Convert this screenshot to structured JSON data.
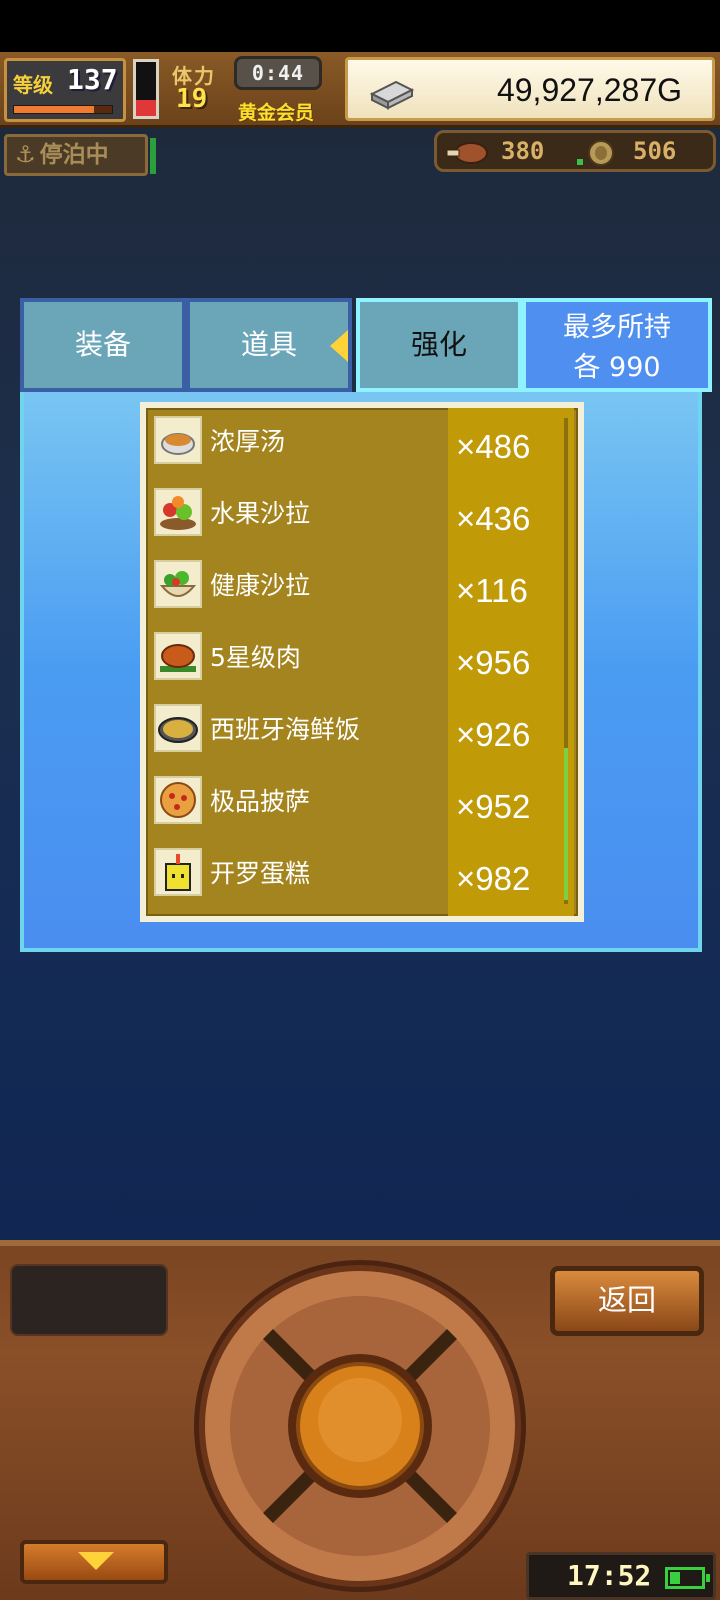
{
  "hud": {
    "level_label": "等级",
    "level_value": "137",
    "exp_fraction": 0.82,
    "stamina_fraction": 0.3,
    "stamina_label": "体力",
    "stamina_value": "19",
    "timer": "0:44",
    "member_label": "黄金会员",
    "gold": "49,927,287G",
    "dock_status": "停泊中",
    "resource_food": "380",
    "resource_medal": "506"
  },
  "tabs": [
    {
      "label": "装备"
    },
    {
      "label": "道具"
    },
    {
      "label": "强化"
    }
  ],
  "max_hold": {
    "line1": "最多所持",
    "line2": "各 990"
  },
  "items": [
    {
      "name": "浓厚汤",
      "qty": "×486",
      "icon": "soup-icon"
    },
    {
      "name": "水果沙拉",
      "qty": "×436",
      "icon": "fruit-salad-icon"
    },
    {
      "name": "健康沙拉",
      "qty": "×116",
      "icon": "healthy-salad-icon"
    },
    {
      "name": "5星级肉",
      "qty": "×956",
      "icon": "meat-icon"
    },
    {
      "name": "西班牙海鲜饭",
      "qty": "×926",
      "icon": "paella-icon"
    },
    {
      "name": "极品披萨",
      "qty": "×952",
      "icon": "pizza-icon"
    },
    {
      "name": "开罗蛋糕",
      "qty": "×982",
      "icon": "cake-icon"
    }
  ],
  "console": {
    "back_label": "返回",
    "clock": "17:52"
  },
  "colors": {
    "panel_blue": "#4a9cf2",
    "list_gold": "#a4841e",
    "tab_active_border": "#8ff2ff",
    "accent_yellow": "#ffd23a"
  }
}
